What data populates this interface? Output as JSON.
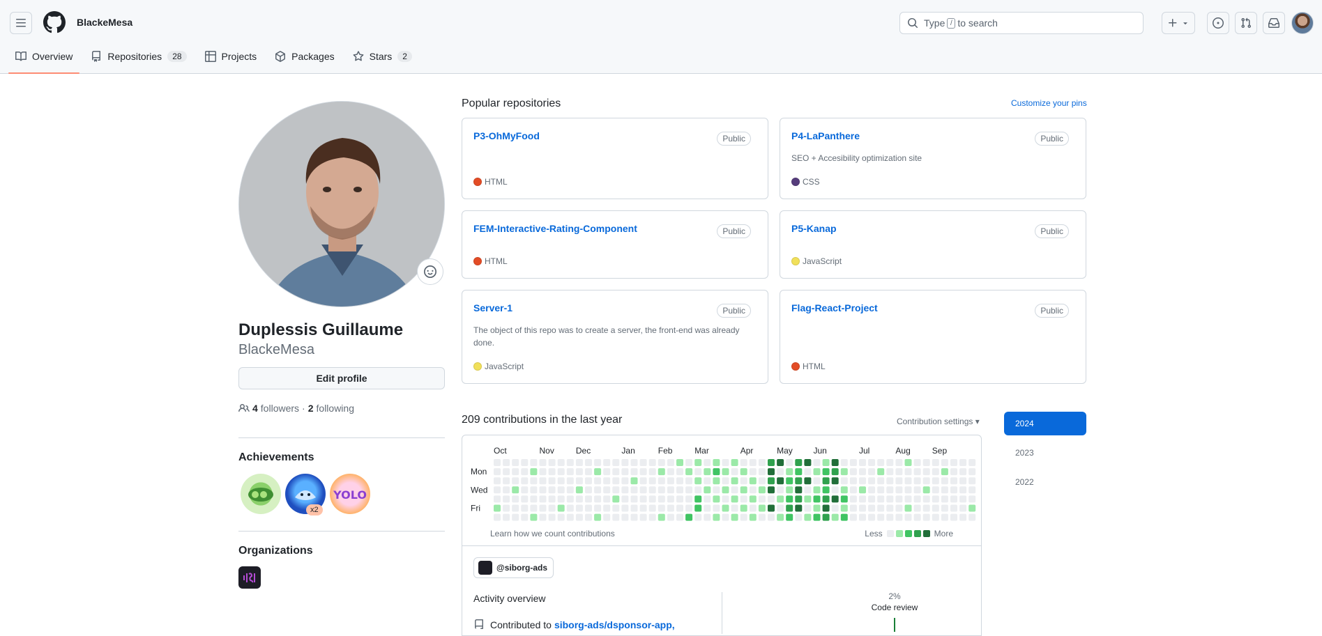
{
  "header": {
    "username": "BlackeMesa",
    "search_text_before": "Type",
    "search_key": "/",
    "search_text_after": "to search"
  },
  "tabs": [
    {
      "label": "Overview",
      "icon": "book-icon",
      "active": true
    },
    {
      "label": "Repositories",
      "icon": "repo-icon",
      "count": "28"
    },
    {
      "label": "Projects",
      "icon": "table-icon"
    },
    {
      "label": "Packages",
      "icon": "package-icon"
    },
    {
      "label": "Stars",
      "icon": "star-icon",
      "count": "2"
    }
  ],
  "profile": {
    "fullname": "Duplessis Guillaume",
    "nickname": "BlackeMesa",
    "edit_label": "Edit profile",
    "followers_count": "4",
    "followers_label": "followers",
    "separator": "·",
    "following_count": "2",
    "following_label": "following",
    "achievements_title": "Achievements",
    "achievement_badge_multiplier": "x2",
    "organizations_title": "Organizations"
  },
  "popular": {
    "title": "Popular repositories",
    "customize": "Customize your pins",
    "repos": [
      {
        "name": "P3-OhMyFood",
        "visibility": "Public",
        "description": "",
        "language": "HTML",
        "lang_color": "#e34c26"
      },
      {
        "name": "P4-LaPanthere",
        "visibility": "Public",
        "description": "SEO + Accesibility optimization site",
        "language": "CSS",
        "lang_color": "#563d7c"
      },
      {
        "name": "FEM-Interactive-Rating-Component",
        "visibility": "Public",
        "description": "",
        "language": "HTML",
        "lang_color": "#e34c26"
      },
      {
        "name": "P5-Kanap",
        "visibility": "Public",
        "description": "",
        "language": "JavaScript",
        "lang_color": "#f1e05a"
      },
      {
        "name": "Server-1",
        "visibility": "Public",
        "description": "The object of this repo was to create a server, the front-end was already done.",
        "language": "JavaScript",
        "lang_color": "#f1e05a"
      },
      {
        "name": "Flag-React-Project",
        "visibility": "Public",
        "description": "",
        "language": "HTML",
        "lang_color": "#e34c26"
      }
    ]
  },
  "contributions": {
    "title": "209 contributions in the last year",
    "settings": "Contribution settings ▾",
    "months": [
      "Oct",
      "Nov",
      "Dec",
      "Jan",
      "Feb",
      "Mar",
      "Apr",
      "May",
      "Jun",
      "Jul",
      "Aug",
      "Sep"
    ],
    "days": [
      "Mon",
      "Wed",
      "Fri"
    ],
    "learn": "Learn how we count contributions",
    "less": "Less",
    "more": "More",
    "colors": [
      "#ebedf0",
      "#9be9a8",
      "#40c463",
      "#30a14e",
      "#216e39"
    ]
  },
  "activity": {
    "org": "@siborg-ads",
    "title": "Activity overview",
    "contributed_to": "Contributed to",
    "repo_link": "siborg-ads/dsponsor-app,",
    "pct": "2%",
    "code_review": "Code review"
  },
  "years": [
    "2024",
    "2023",
    "2022"
  ]
}
